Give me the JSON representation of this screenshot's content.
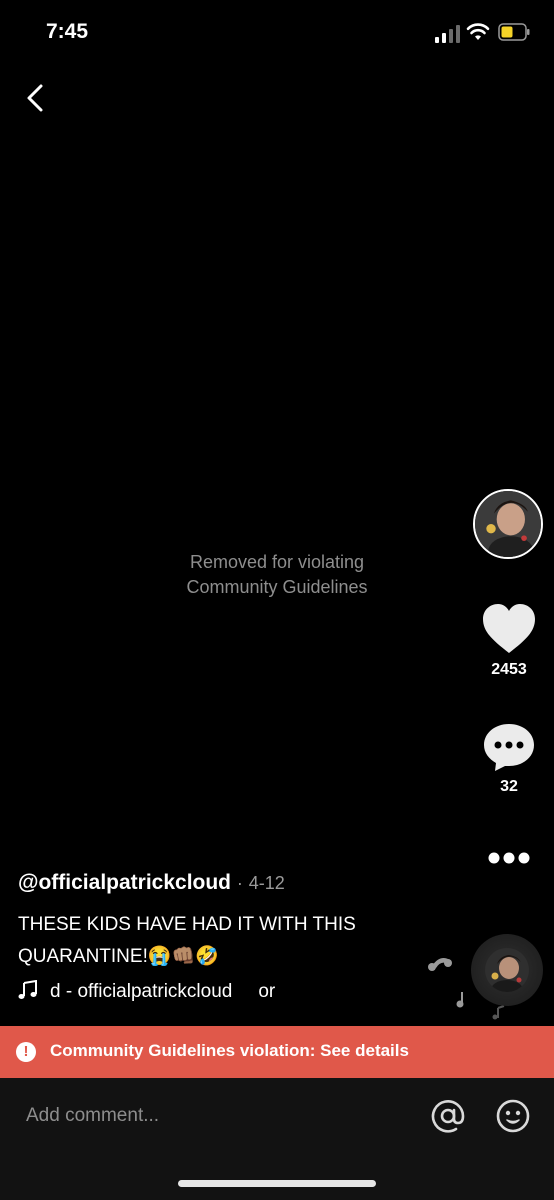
{
  "status_bar": {
    "time": "7:45"
  },
  "video": {
    "removed_message_line1": "Removed for violating",
    "removed_message_line2": "Community Guidelines"
  },
  "actions": {
    "likes": "2453",
    "comments": "32"
  },
  "caption": {
    "username": "@officialpatrickcloud",
    "separator": "·",
    "date": "4-12",
    "text": "THESE KIDS HAVE HAD IT WITH THIS QUARANTINE!😭👊🏽🤣"
  },
  "music": {
    "title": "d - officialpatrickcloud",
    "trailing": "or"
  },
  "violation_banner": {
    "text": "Community Guidelines violation: See details"
  },
  "comment_bar": {
    "placeholder": "Add comment..."
  },
  "colors": {
    "banner": "#e0584a",
    "background": "#000000",
    "muted_text": "#8e8e8e"
  }
}
